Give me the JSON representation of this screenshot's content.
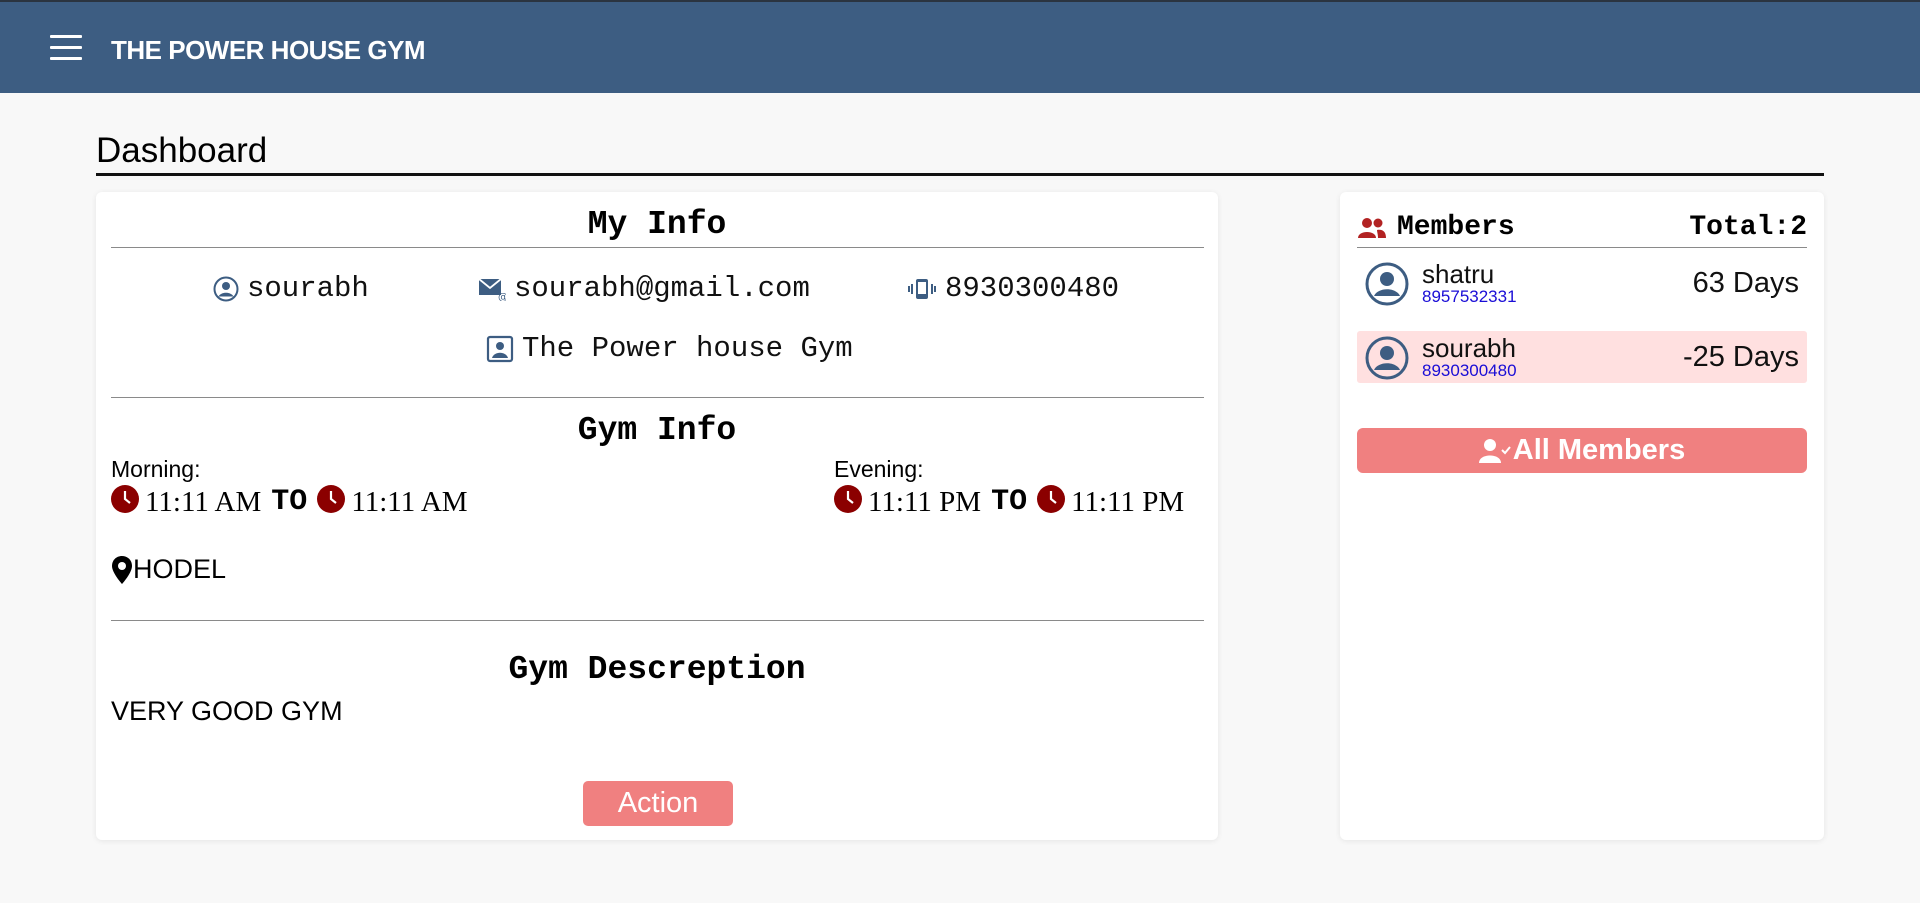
{
  "header": {
    "title": "THE POWER HOUSE GYM",
    "menu_icon": "hamburger-menu-icon"
  },
  "page_title": "Dashboard",
  "my_info": {
    "title": "My Info",
    "name": "sourabh",
    "email": "sourabh@gmail.com",
    "phone": "8930300480",
    "gym_name": "The Power house Gym",
    "icons": [
      "user-circle-icon",
      "mail-icon",
      "phone-vibrate-icon",
      "portrait-icon"
    ]
  },
  "gym_info": {
    "title": "Gym Info",
    "morning": {
      "label": "Morning:",
      "from": "11:11 AM",
      "to_label": "TO",
      "to": "11:11 AM"
    },
    "evening": {
      "label": "Evening:",
      "from": "11:11 PM",
      "to_label": "TO",
      "to": "11:11 PM"
    },
    "location": "HODEL",
    "clock_color": "#8b0000"
  },
  "description": {
    "title": "Gym Descreption",
    "text": "VERY GOOD GYM"
  },
  "action_button": "Action",
  "members": {
    "title": "Members",
    "total": "Total:2",
    "list": [
      {
        "name": "shatru",
        "phone": "8957532331",
        "days": "63 Days",
        "expired": false
      },
      {
        "name": "sourabh",
        "phone": "8930300480",
        "days": "-25 Days",
        "expired": true
      }
    ],
    "all_button": "All Members"
  },
  "colors": {
    "header": "#3d5d82",
    "accent_button": "#f08080",
    "expired_row": "#ffe0e0",
    "phone_link": "#1a0dd6",
    "members_icon": "#b22222"
  }
}
